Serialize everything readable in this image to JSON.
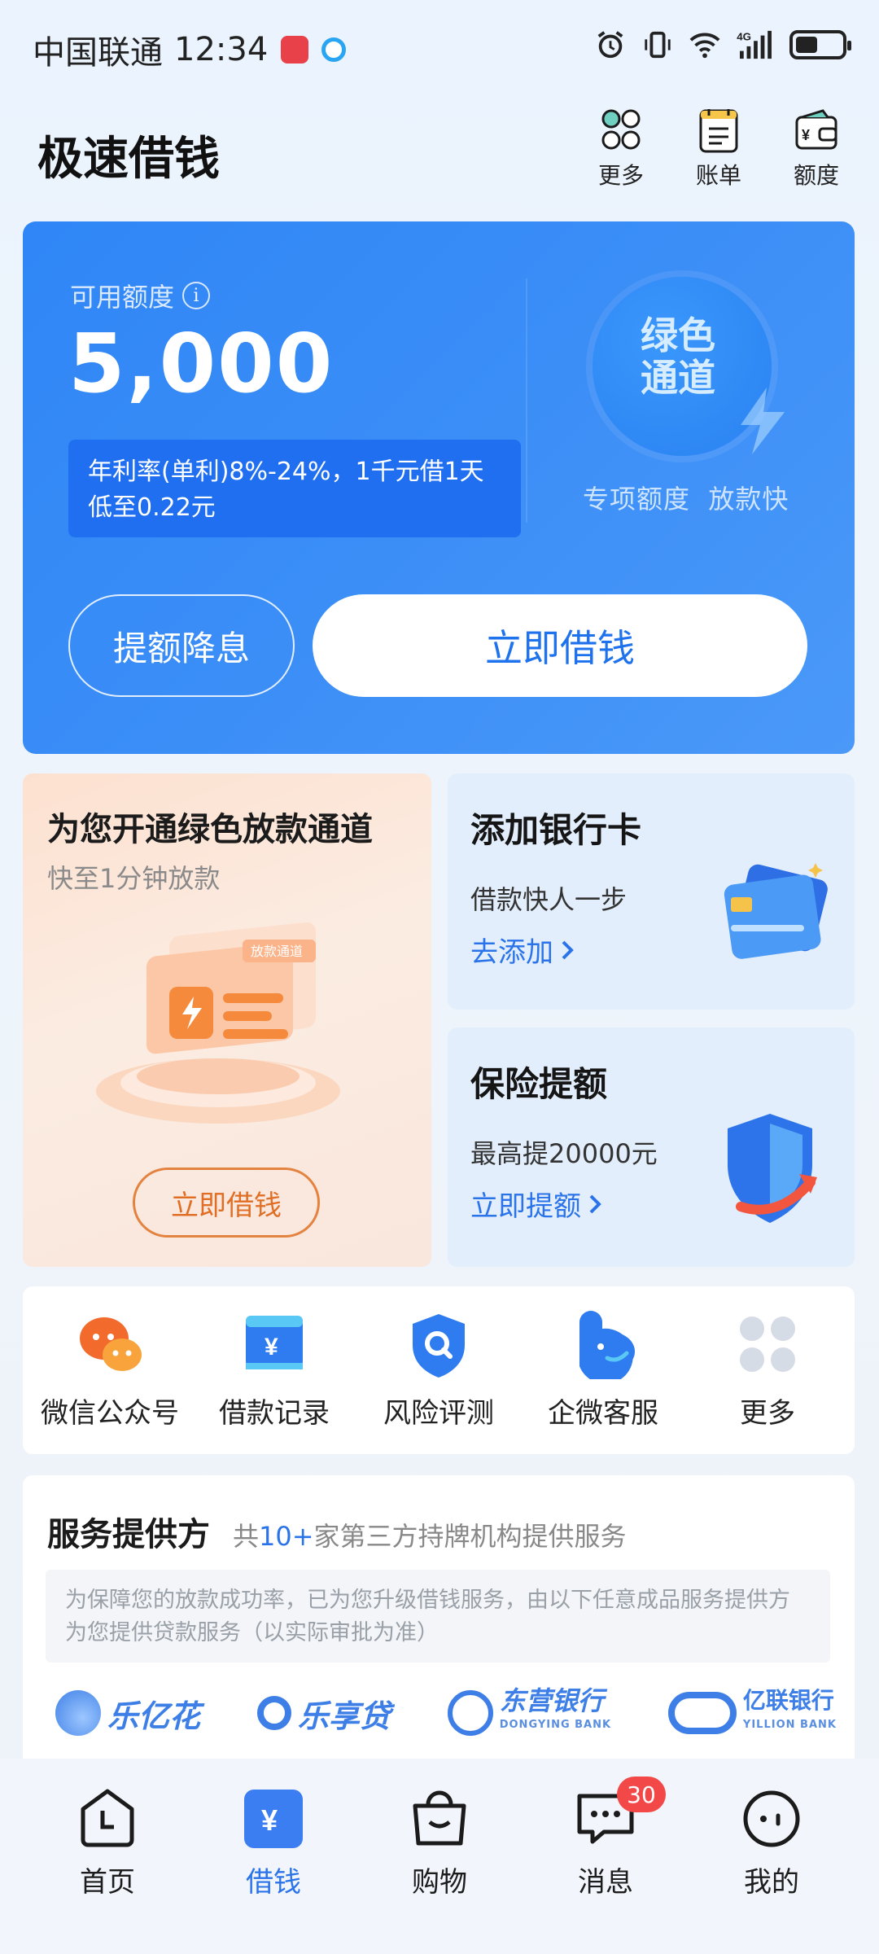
{
  "status_bar": {
    "carrier": "中国联通",
    "time": "12:34",
    "network": "4G",
    "battery_level": 0.4
  },
  "header": {
    "title": "极速借钱",
    "actions": [
      {
        "label": "更多",
        "icon": "more-circles-icon"
      },
      {
        "label": "账单",
        "icon": "bill-icon"
      },
      {
        "label": "额度",
        "icon": "wallet-icon"
      }
    ]
  },
  "credit": {
    "available_label": "可用额度",
    "info_icon": "i",
    "amount": "5,000",
    "rate_text": "年利率(单利)8%-24%，1千元借1天低至0.22元",
    "green_channel": "绿色通道",
    "green_sub": "专项额度  放款快",
    "raise_button": "提额降息",
    "borrow_button": "立即借钱",
    "colors": {
      "card": "#2f86f6",
      "accent": "#1f72ee"
    }
  },
  "promos": {
    "left": {
      "title": "为您开通绿色放款通道",
      "subtitle": "快至1分钟放款",
      "badge": "放款通道",
      "button": "立即借钱"
    },
    "bank_card": {
      "title": "添加银行卡",
      "subtitle": "借款快人一步",
      "link": "去添加"
    },
    "insurance": {
      "title": "保险提额",
      "subtitle": "最高提20000元",
      "link": "立即提额"
    }
  },
  "shortcuts": [
    {
      "label": "微信公众号",
      "icon": "wechat-icon"
    },
    {
      "label": "借款记录",
      "icon": "loan-record-icon"
    },
    {
      "label": "风险评测",
      "icon": "risk-shield-icon"
    },
    {
      "label": "企微客服",
      "icon": "customer-service-icon"
    },
    {
      "label": "更多",
      "icon": "grid-more-icon"
    }
  ],
  "providers": {
    "title": "服务提供方",
    "count_prefix": "共",
    "count": "10+",
    "count_suffix": "家第三方持牌机构提供服务",
    "note": "为保障您的放款成功率，已为您升级借钱服务，由以下任意成品服务提供方为您提供贷款服务（以实际审批为准）",
    "logos": [
      {
        "name": "乐亿花"
      },
      {
        "name": "乐享贷"
      },
      {
        "name": "东营银行",
        "en": "DONGYING BANK"
      },
      {
        "name": "亿联银行",
        "en": "YILLION BANK"
      }
    ]
  },
  "bottom_nav": [
    {
      "label": "首页",
      "icon": "home-clock-icon"
    },
    {
      "label": "借钱",
      "icon": "yuan-icon",
      "active": true
    },
    {
      "label": "购物",
      "icon": "shopping-bag-icon"
    },
    {
      "label": "消息",
      "icon": "message-icon",
      "badge": "30"
    },
    {
      "label": "我的",
      "icon": "profile-icon"
    }
  ]
}
